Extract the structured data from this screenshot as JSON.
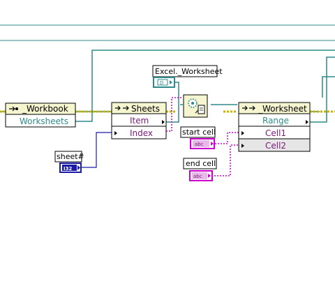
{
  "nodes": {
    "workbook": {
      "header": "_Workbook",
      "property": "Worksheets"
    },
    "sheets": {
      "header": "Sheets",
      "property": "Item",
      "input": "Index"
    },
    "worksheet": {
      "header": "_Worksheet",
      "property": "Range",
      "input1": "Cell1",
      "input2": "Cell2"
    }
  },
  "labels": {
    "excel_worksheet": "Excel._Worksheet",
    "sheet_num": "sheet#",
    "start_cell": "start cell",
    "end_cell": "end cell"
  },
  "terminals": {
    "refnum": "D",
    "i32": "I32",
    "abc": "abc"
  },
  "colors": {
    "refnum_wire": "#2f8a8a",
    "string_wire": "#cc00cc",
    "integer_wire": "#1a1aa8",
    "error_wire": "#c8b400",
    "node_header": "#f5f5d0",
    "property_text": "#2f8a8a",
    "input_text": "#7a1a7a"
  },
  "icons": [
    "refnum-icon",
    "variant-to-data-icon",
    "arrow-property-icon"
  ]
}
